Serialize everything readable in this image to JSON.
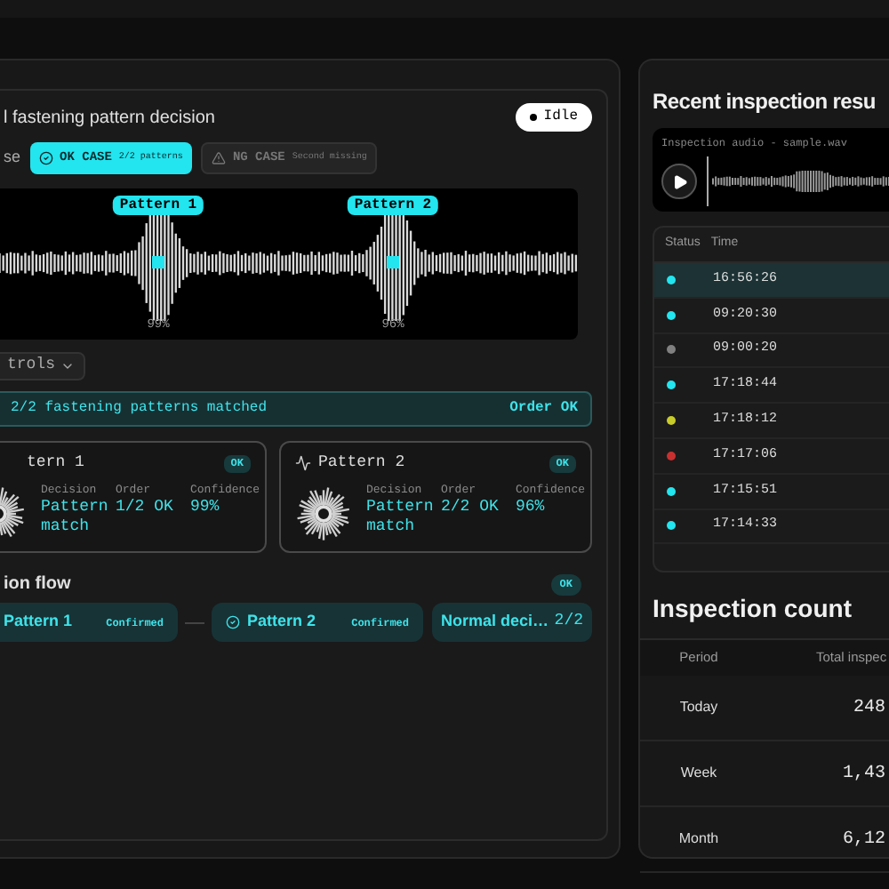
{
  "panel": {
    "title": "l fastening pattern decision",
    "status": "Idle"
  },
  "case_selector": {
    "label": "se",
    "options": [
      {
        "kind": "ok",
        "name": "OK CASE",
        "detail": "2/2 patterns",
        "selected": true
      },
      {
        "kind": "ng",
        "name": "NG CASE",
        "detail": "Second missing",
        "selected": false
      }
    ]
  },
  "waveform": {
    "markers": [
      {
        "label": "Pattern 1",
        "reading": "99%"
      },
      {
        "label": "Pattern 2",
        "reading": "96%"
      }
    ]
  },
  "controls_dropdown": "trols",
  "result_banner": {
    "message": "2/2 fastening patterns matched",
    "verdict": "Order OK"
  },
  "pattern_cards": [
    {
      "title": "tern 1",
      "badge": "OK",
      "fields": [
        {
          "label": "Decision",
          "value": "Pattern match"
        },
        {
          "label": "Order",
          "value": "1/2 OK"
        },
        {
          "label": "Confidence",
          "value": "99%"
        }
      ]
    },
    {
      "title": "Pattern 2",
      "badge": "OK",
      "fields": [
        {
          "label": "Decision",
          "value": "Pattern match"
        },
        {
          "label": "Order",
          "value": "2/2 OK"
        },
        {
          "label": "Confidence",
          "value": "96%"
        }
      ]
    }
  ],
  "decision_flow": {
    "title": "ion flow",
    "badge": "OK",
    "steps": [
      {
        "kind": "confirmed",
        "name": "Pattern 1",
        "status": "Confirmed"
      },
      {
        "kind": "confirmed",
        "name": "Pattern 2",
        "status": "Confirmed"
      },
      {
        "kind": "summary",
        "name": "Normal deci…",
        "status": "2/2"
      }
    ]
  },
  "recent": {
    "title": "Recent inspection resu",
    "audio": {
      "file": "Inspection audio - sample.wav"
    },
    "columns": [
      "Status",
      "Time"
    ],
    "rows": [
      {
        "color": "#22e5ef",
        "time": "16:56:26",
        "selected": true
      },
      {
        "color": "#22e5ef",
        "time": "09:20:30",
        "selected": false
      },
      {
        "color": "#808080",
        "time": "09:00:20",
        "selected": false
      },
      {
        "color": "#22e5ef",
        "time": "17:18:44",
        "selected": false
      },
      {
        "color": "#c8cc2a",
        "time": "17:18:12",
        "selected": false
      },
      {
        "color": "#c83030",
        "time": "17:17:06",
        "selected": false
      },
      {
        "color": "#22e5ef",
        "time": "17:15:51",
        "selected": false
      },
      {
        "color": "#22e5ef",
        "time": "17:14:33",
        "selected": false
      }
    ]
  },
  "count": {
    "title": "Inspection count",
    "columns": [
      "Period",
      "Total inspec"
    ],
    "rows": [
      {
        "period": "Today",
        "total": "248"
      },
      {
        "period": "Week",
        "total": "1,43"
      },
      {
        "period": "Month",
        "total": "6,12"
      }
    ]
  }
}
